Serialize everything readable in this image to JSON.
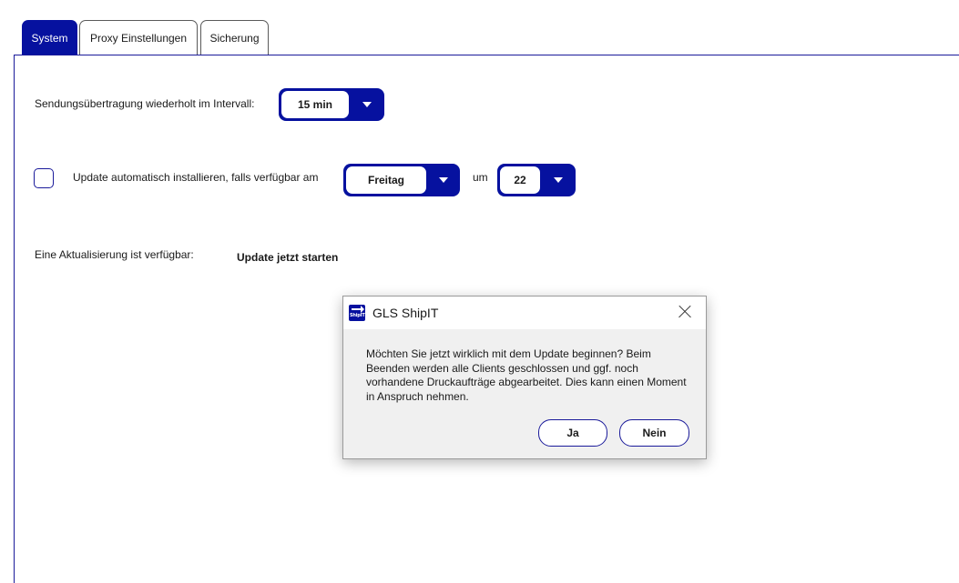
{
  "tabs": [
    {
      "label": "System",
      "active": true
    },
    {
      "label": "Proxy Einstellungen",
      "active": false
    },
    {
      "label": "Sicherung",
      "active": false
    }
  ],
  "interval": {
    "label": "Sendungsübertragung wiederholt im Intervall:",
    "value": "15 min"
  },
  "auto_update": {
    "checked": false,
    "label": "Update automatisch installieren, falls verfügbar am",
    "day_value": "Freitag",
    "at_label": "um",
    "hour_value": "22"
  },
  "update_available": {
    "label": "Eine Aktualisierung ist verfügbar:",
    "action": "Update jetzt starten"
  },
  "dialog": {
    "title": "GLS ShipIT",
    "icon_text": "ShipIT",
    "message": "Möchten Sie jetzt wirklich  mit dem Update beginnen? Beim Beenden werden alle Clients geschlossen und ggf. noch vorhandene Druckaufträge abgearbeitet. Dies kann einen Moment in Anspruch nehmen.",
    "yes_label": "Ja",
    "no_label": "Nein"
  },
  "colors": {
    "accent": "#06119f",
    "dialog_bg": "#f0f0f0"
  }
}
